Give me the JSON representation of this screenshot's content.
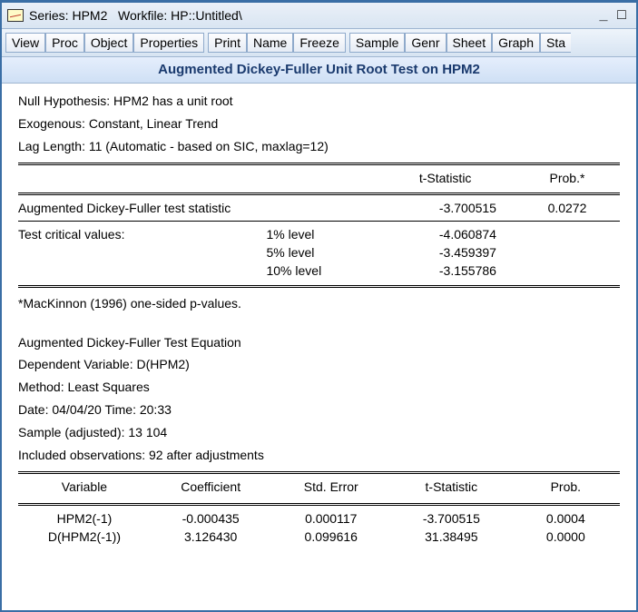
{
  "title_bar": {
    "series_prefix": "Series: ",
    "series_name": "HPM2",
    "workfile_prefix": "   Workfile: ",
    "workfile_name": "HP::Untitled\\"
  },
  "toolbar": {
    "view": "View",
    "proc": "Proc",
    "object": "Object",
    "properties": "Properties",
    "print": "Print",
    "name": "Name",
    "freeze": "Freeze",
    "sample": "Sample",
    "genr": "Genr",
    "sheet": "Sheet",
    "graph": "Graph",
    "stats": "Sta"
  },
  "subtitle": "Augmented Dickey-Fuller Unit Root Test on HPM2",
  "header": {
    "null_hyp": "Null Hypothesis: HPM2 has a unit root",
    "exogenous": "Exogenous: Constant, Linear Trend",
    "lag_length": "Lag Length: 11 (Automatic - based on SIC, maxlag=12)"
  },
  "cols": {
    "tstat": "t-Statistic",
    "prob_star": "Prob.*"
  },
  "stats": {
    "adf_label": "Augmented Dickey-Fuller test statistic",
    "adf_t": "-3.700515",
    "adf_p": "0.0272",
    "crit_label": "Test critical values:",
    "l1_label": "1% level",
    "l1_val": "-4.060874",
    "l5_label": "5% level",
    "l5_val": "-3.459397",
    "l10_label": "10% level",
    "l10_val": "-3.155786"
  },
  "footnote": "*MacKinnon (1996) one-sided p-values.",
  "eq_header": {
    "l1": "Augmented Dickey-Fuller Test Equation",
    "l2": "Dependent Variable: D(HPM2)",
    "l3": "Method: Least Squares",
    "l4": "Date: 04/04/20   Time: 20:33",
    "l5": "Sample (adjusted): 13 104",
    "l6": "Included observations: 92 after adjustments"
  },
  "var_cols": {
    "variable": "Variable",
    "coef": "Coefficient",
    "se": "Std. Error",
    "tstat": "t-Statistic",
    "prob": "Prob."
  },
  "vars": {
    "r1_name": "HPM2(-1)",
    "r1_coef": "-0.000435",
    "r1_se": "0.000117",
    "r1_t": "-3.700515",
    "r1_p": "0.0004",
    "r2_name": "D(HPM2(-1))",
    "r2_coef": "3.126430",
    "r2_se": "0.099616",
    "r2_t": "31.38495",
    "r2_p": "0.0000"
  }
}
